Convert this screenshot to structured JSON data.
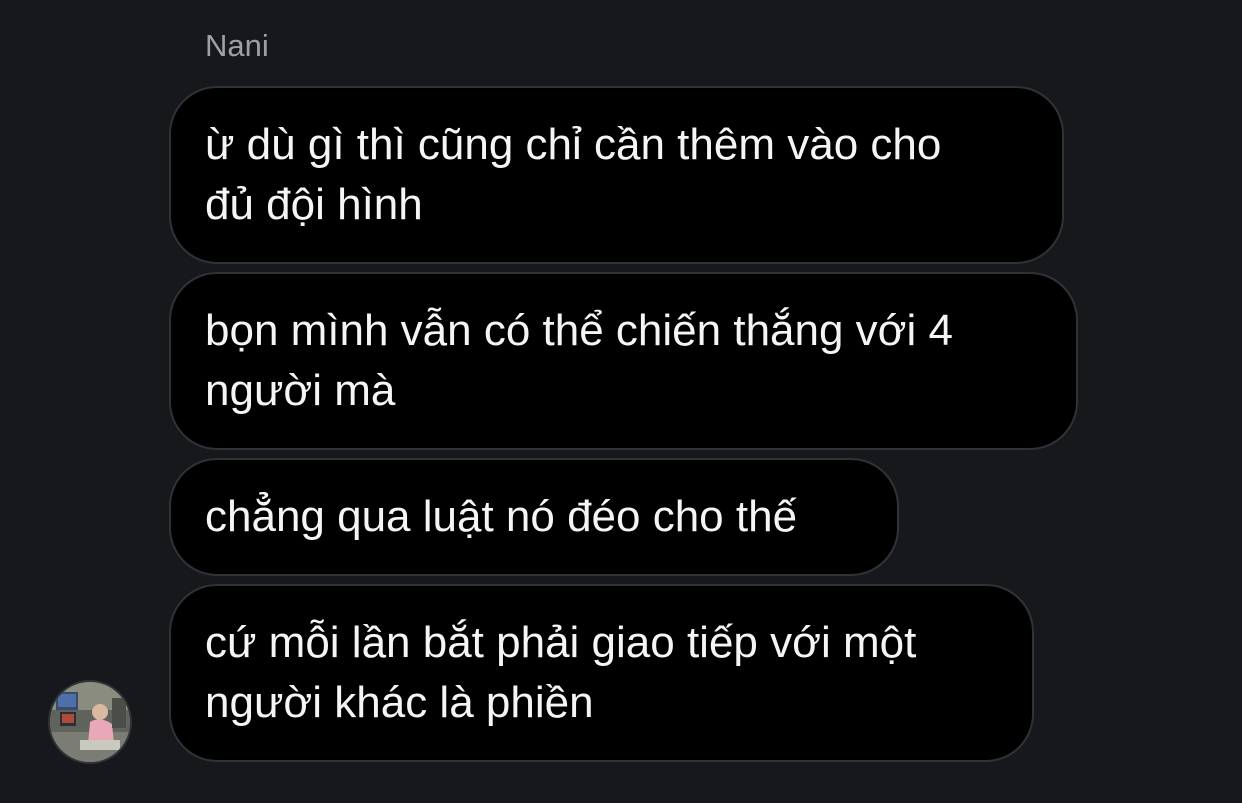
{
  "conversation": {
    "sender_name": "Nani",
    "messages": [
      {
        "text": "ừ dù gì thì cũng chỉ cần thêm vào cho\nđủ đội hình"
      },
      {
        "text": "bọn mình vẫn có thể chiến thắng với 4\nngười mà"
      },
      {
        "text": "chẳng qua luật nó đéo cho thế"
      },
      {
        "text": "cứ mỗi lần bắt phải giao tiếp với một\nngười khác là phiền"
      }
    ],
    "avatar_icon": "user-avatar-photo"
  },
  "colors": {
    "background": "#16181c",
    "bubble": "#000000",
    "bubble_border": "#2f3338",
    "text": "#f5f5f5",
    "sender_name": "#9ca1a8"
  }
}
